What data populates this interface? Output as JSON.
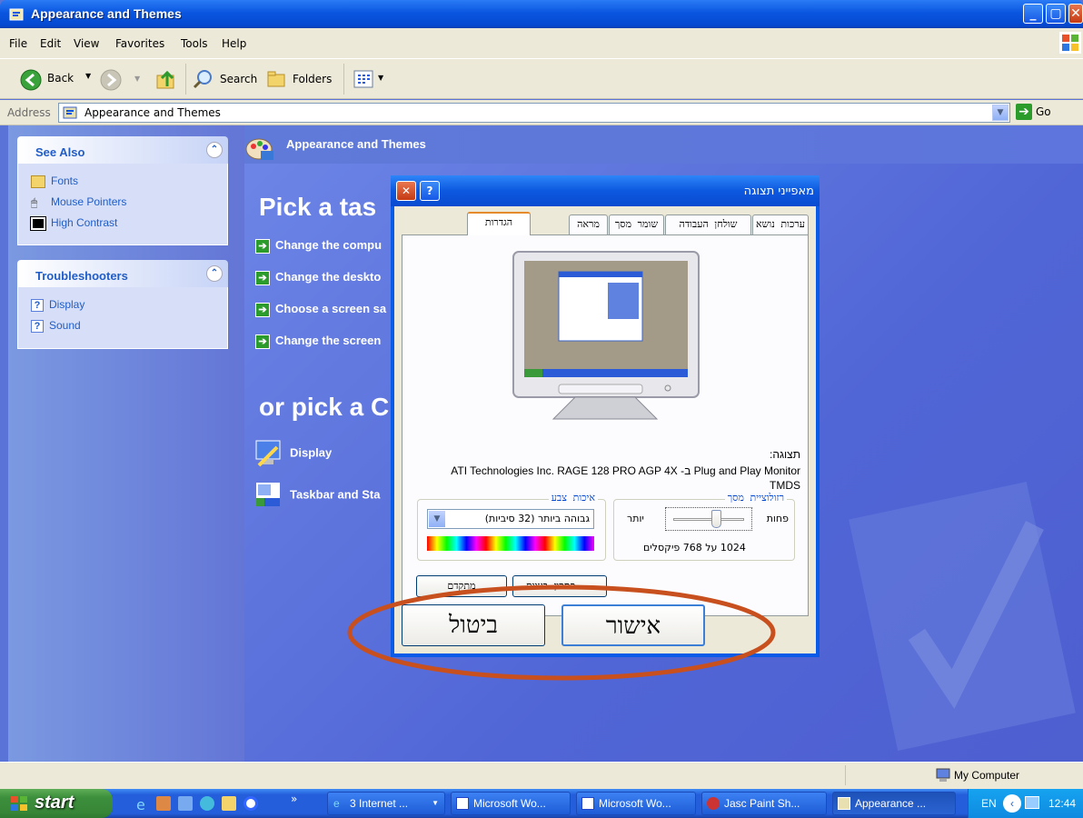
{
  "window": {
    "title": "Appearance and Themes"
  },
  "menu": [
    "File",
    "Edit",
    "View",
    "Favorites",
    "Tools",
    "Help"
  ],
  "toolbar": {
    "back": "Back",
    "search": "Search",
    "folders": "Folders"
  },
  "address": {
    "label": "Address",
    "value": "Appearance and Themes",
    "go": "Go"
  },
  "sidebar": {
    "see_also": {
      "title": "See Also",
      "items": [
        "Fonts",
        "Mouse Pointers",
        "High Contrast"
      ]
    },
    "troubleshooters": {
      "title": "Troubleshooters",
      "items": [
        "Display",
        "Sound"
      ]
    }
  },
  "main": {
    "header": "Appearance and Themes",
    "pick_task": "Pick a tas",
    "tasks": [
      "Change the compu",
      "Change the deskto",
      "Choose a screen sa",
      "Change the screen"
    ],
    "pick_icon": "or pick a C",
    "icons": [
      "Display",
      "Taskbar and Sta"
    ]
  },
  "dialog": {
    "title": "מאפייני תצוגה",
    "tabs": [
      "ערכות נושא",
      "שולחן העבודה",
      "שומר מסך",
      "מראה",
      "הגדרות"
    ],
    "display_label": "תצוגה:",
    "display_value_1": "ATI Technologies Inc. RAGE 128 PRO AGP 4X -ב Plug and Play Monitor",
    "display_value_2": "TMDS",
    "resolution": {
      "label": "רזולוציית מסך",
      "less": "פחות",
      "more": "יותר",
      "value": "1024 על 768 פיקסלים",
      "level": 0.6
    },
    "color": {
      "label": "איכות צבע",
      "value": "גבוהה ביותר (32 סיביות)"
    },
    "troubleshoot_btn": "פתרון בעיות...",
    "advanced_btn": "מתקדם",
    "ok_btn": "אישור",
    "cancel_btn": "ביטול"
  },
  "status": {
    "zone": "My Computer"
  },
  "taskbar": {
    "start": "start",
    "buttons": [
      "3 Internet ...",
      "Microsoft Wo...",
      "Microsoft Wo...",
      "Jasc Paint Sh...",
      "Appearance ..."
    ],
    "lang": "EN",
    "clock": "12:44"
  },
  "colors": {
    "accent": "#0a56e0",
    "highlight_circle": "#c8501e"
  }
}
